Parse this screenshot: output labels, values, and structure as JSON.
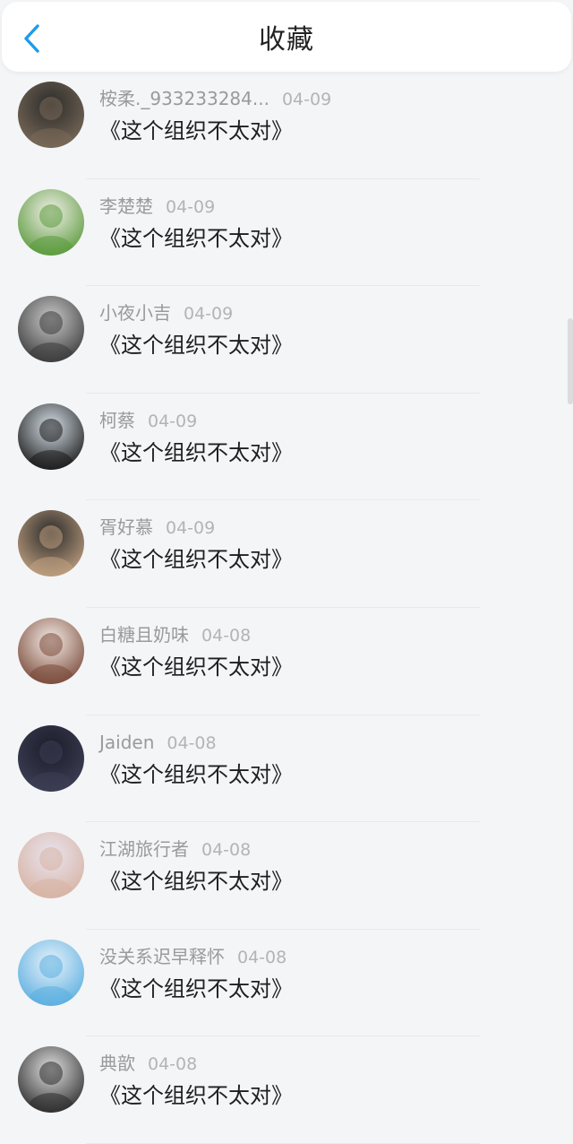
{
  "header": {
    "title": "收藏",
    "back_icon": "chevron-left-icon",
    "accent": "#1e9bea"
  },
  "items": [
    {
      "user": "桉柔._933233284...",
      "date": "04-09",
      "title": "《这个组织不太对》",
      "avatar_colors": [
        "#2b2b2b",
        "#7a6a58"
      ]
    },
    {
      "user": "李楚楚",
      "date": "04-09",
      "title": "《这个组织不太对》",
      "avatar_colors": [
        "#f2efe9",
        "#5a9a3c"
      ]
    },
    {
      "user": "小夜小吉",
      "date": "04-09",
      "title": "《这个组织不太对》",
      "avatar_colors": [
        "#c9c9c9",
        "#3b3b3b"
      ]
    },
    {
      "user": "柯蔡",
      "date": "04-09",
      "title": "《这个组织不太对》",
      "avatar_colors": [
        "#d6e0e8",
        "#1a1a1a"
      ]
    },
    {
      "user": "胥好慕",
      "date": "04-09",
      "title": "《这个组织不太对》",
      "avatar_colors": [
        "#2a2a2a",
        "#c0a080"
      ]
    },
    {
      "user": "白糖且奶味",
      "date": "04-08",
      "title": "《这个组织不太对》",
      "avatar_colors": [
        "#f5ece6",
        "#7a4a3a"
      ]
    },
    {
      "user": "Jaiden",
      "date": "04-08",
      "title": "《这个组织不太对》",
      "avatar_colors": [
        "#1b1d2a",
        "#3d3f55"
      ]
    },
    {
      "user": "江湖旅行者",
      "date": "04-08",
      "title": "《这个组织不太对》",
      "avatar_colors": [
        "#e9e4ef",
        "#d7b3a3"
      ]
    },
    {
      "user": "没关系迟早释怀",
      "date": "04-08",
      "title": "《这个组织不太对》",
      "avatar_colors": [
        "#e8f2fa",
        "#5aaee0"
      ]
    },
    {
      "user": "典歆",
      "date": "04-08",
      "title": "《这个组织不太对》",
      "avatar_colors": [
        "#e0e0e0",
        "#2c2c2c"
      ]
    }
  ]
}
